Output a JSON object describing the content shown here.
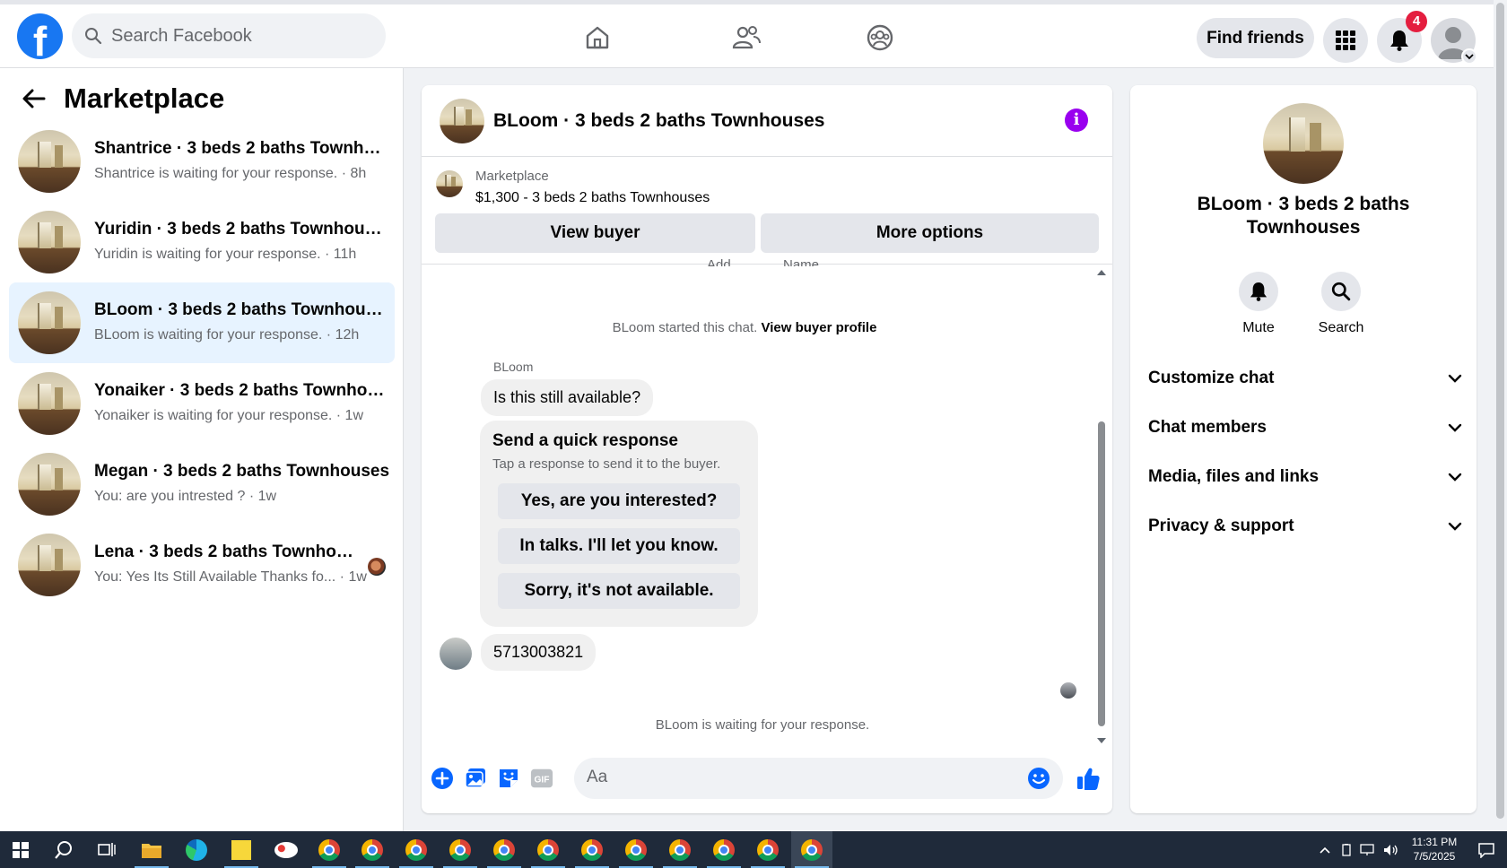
{
  "topbar": {
    "logo": "f",
    "search_placeholder": "Search Facebook",
    "find_friends": "Find friends",
    "notification_count": "4",
    "icons": [
      "home-icon",
      "friends-icon",
      "groups-icon",
      "menu-grid-icon",
      "bell-icon",
      "profile-avatar"
    ]
  },
  "sidebar": {
    "title": "Marketplace",
    "conversations": [
      {
        "name": "Shantrice · 3 beds 2 baths Townhouses",
        "sub": "Shantrice is waiting for your response. · 8h",
        "active": false
      },
      {
        "name": "Yuridin · 3 beds 2 baths Townhouses",
        "sub": "Yuridin is waiting for your response. · 11h",
        "active": false
      },
      {
        "name": "BLoom · 3 beds 2 baths Townhouses",
        "sub": "BLoom is waiting for your response. · 12h",
        "active": true
      },
      {
        "name": "Yonaiker · 3 beds 2 baths Townhouses",
        "sub": "Yonaiker is waiting for your response. · 1w",
        "active": false
      },
      {
        "name": "Megan · 3 beds 2 baths Townhouses",
        "sub": "You: are you intrested ? · 1w",
        "active": false
      },
      {
        "name": "Lena · 3 beds 2 baths Townhouses",
        "sub": "You: Yes Its Still Available Thanks fo... · 1w",
        "active": false
      }
    ]
  },
  "chat": {
    "title": "BLoom · 3 beds 2 baths Townhouses",
    "listing_label": "Marketplace",
    "listing_price": "$1,300 - 3 beds 2 baths Townhouses",
    "view_buyer": "View buyer",
    "more_options": "More options",
    "cut_left": "Add",
    "cut_right": "Name",
    "started_text": "BLoom started this chat.",
    "view_profile_link": "View buyer profile",
    "sender_name": "BLoom",
    "message_1": "Is this still available?",
    "quick_title": "Send a quick response",
    "quick_sub": "Tap a response to send it to the buyer.",
    "quick_options": [
      "Yes, are you interested?",
      "In talks. I'll let you know.",
      "Sorry, it's not available."
    ],
    "message_2": "5713003821",
    "waiting_text": "BLoom is waiting for your response.",
    "composer_placeholder": "Aa",
    "gif_label": "GIF"
  },
  "info_panel": {
    "title": "BLoom · 3 beds 2 baths Townhouses",
    "mute": "Mute",
    "search": "Search",
    "sections": [
      "Customize chat",
      "Chat members",
      "Media, files and links",
      "Privacy & support"
    ]
  },
  "taskbar": {
    "time": "11:31 PM",
    "date": "7/5/2025"
  },
  "colors": {
    "brand": "#1877f2",
    "active_conv": "#e7f3ff",
    "info": "#9900ef",
    "badge": "#e41e3f"
  }
}
